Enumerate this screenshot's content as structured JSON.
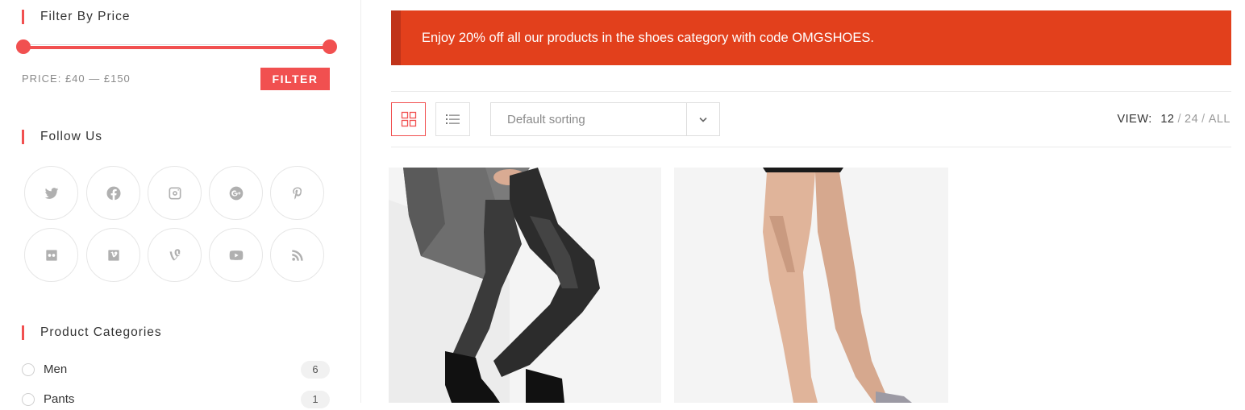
{
  "sidebar": {
    "filter_by_price": {
      "title": "Filter By Price",
      "price_label": "PRICE: £40 — £150",
      "button_label": "FILTER",
      "range_min_fraction": 0,
      "range_max_fraction": 1
    },
    "follow_us": {
      "title": "Follow Us",
      "networks": [
        "twitter-icon",
        "facebook-icon",
        "instagram-icon",
        "google-plus-icon",
        "pinterest-icon",
        "flickr-icon",
        "vimeo-icon",
        "vine-icon",
        "youtube-icon",
        "rss-icon"
      ]
    },
    "product_categories": {
      "title": "Product Categories",
      "items": [
        {
          "label": "Men",
          "count": "6"
        },
        {
          "label": "Pants",
          "count": "1"
        }
      ]
    }
  },
  "main": {
    "promo_text": "Enjoy 20% off all our products in the shoes category with code OMGSHOES.",
    "toolbar": {
      "grid_view_icon": "grid-icon",
      "list_view_icon": "list-icon",
      "sorting_value": "Default sorting",
      "view_label": "VIEW:",
      "view_current": "12",
      "view_options": [
        "24",
        "ALL"
      ]
    },
    "products": [
      {
        "image": "product-image-jeans-boots"
      },
      {
        "image": "product-image-legs-heels"
      }
    ]
  },
  "colors": {
    "accent": "#f15050",
    "promo_bg": "#e2401c",
    "promo_border": "#c0341a",
    "icon_gray": "#b0b0b0"
  }
}
